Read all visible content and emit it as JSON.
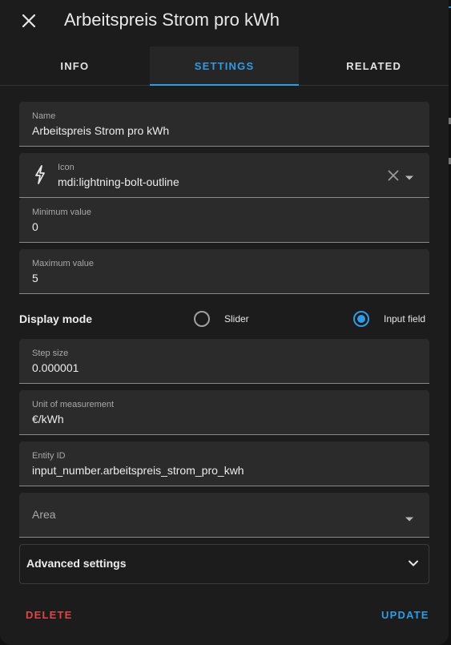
{
  "dialog": {
    "title": "Arbeitspreis Strom pro kWh"
  },
  "tabs": [
    {
      "label": "INFO",
      "active": false
    },
    {
      "label": "SETTINGS",
      "active": true
    },
    {
      "label": "RELATED",
      "active": false
    }
  ],
  "form": {
    "name": {
      "label": "Name",
      "value": "Arbeitspreis Strom pro kWh"
    },
    "icon": {
      "label": "Icon",
      "value": "mdi:lightning-bolt-outline",
      "icon": "lightning-bolt-outline-icon"
    },
    "min": {
      "label": "Minimum value",
      "value": "0"
    },
    "max": {
      "label": "Maximum value",
      "value": "5"
    },
    "display_mode": {
      "label": "Display mode",
      "options": [
        {
          "label": "Slider",
          "selected": false
        },
        {
          "label": "Input field",
          "selected": true
        }
      ]
    },
    "step": {
      "label": "Step size",
      "value": "0.000001"
    },
    "unit": {
      "label": "Unit of measurement",
      "value": "€/kWh"
    },
    "entity_id": {
      "label": "Entity ID",
      "value": "input_number.arbeitspreis_strom_pro_kwh"
    },
    "area": {
      "placeholder": "Area"
    },
    "advanced": {
      "label": "Advanced settings"
    }
  },
  "actions": {
    "delete": "DELETE",
    "update": "UPDATE"
  },
  "colors": {
    "accent": "#2f9be6",
    "danger": "#e24444",
    "surface": "#1c1c1c",
    "field_bg": "#2b2b2b"
  }
}
